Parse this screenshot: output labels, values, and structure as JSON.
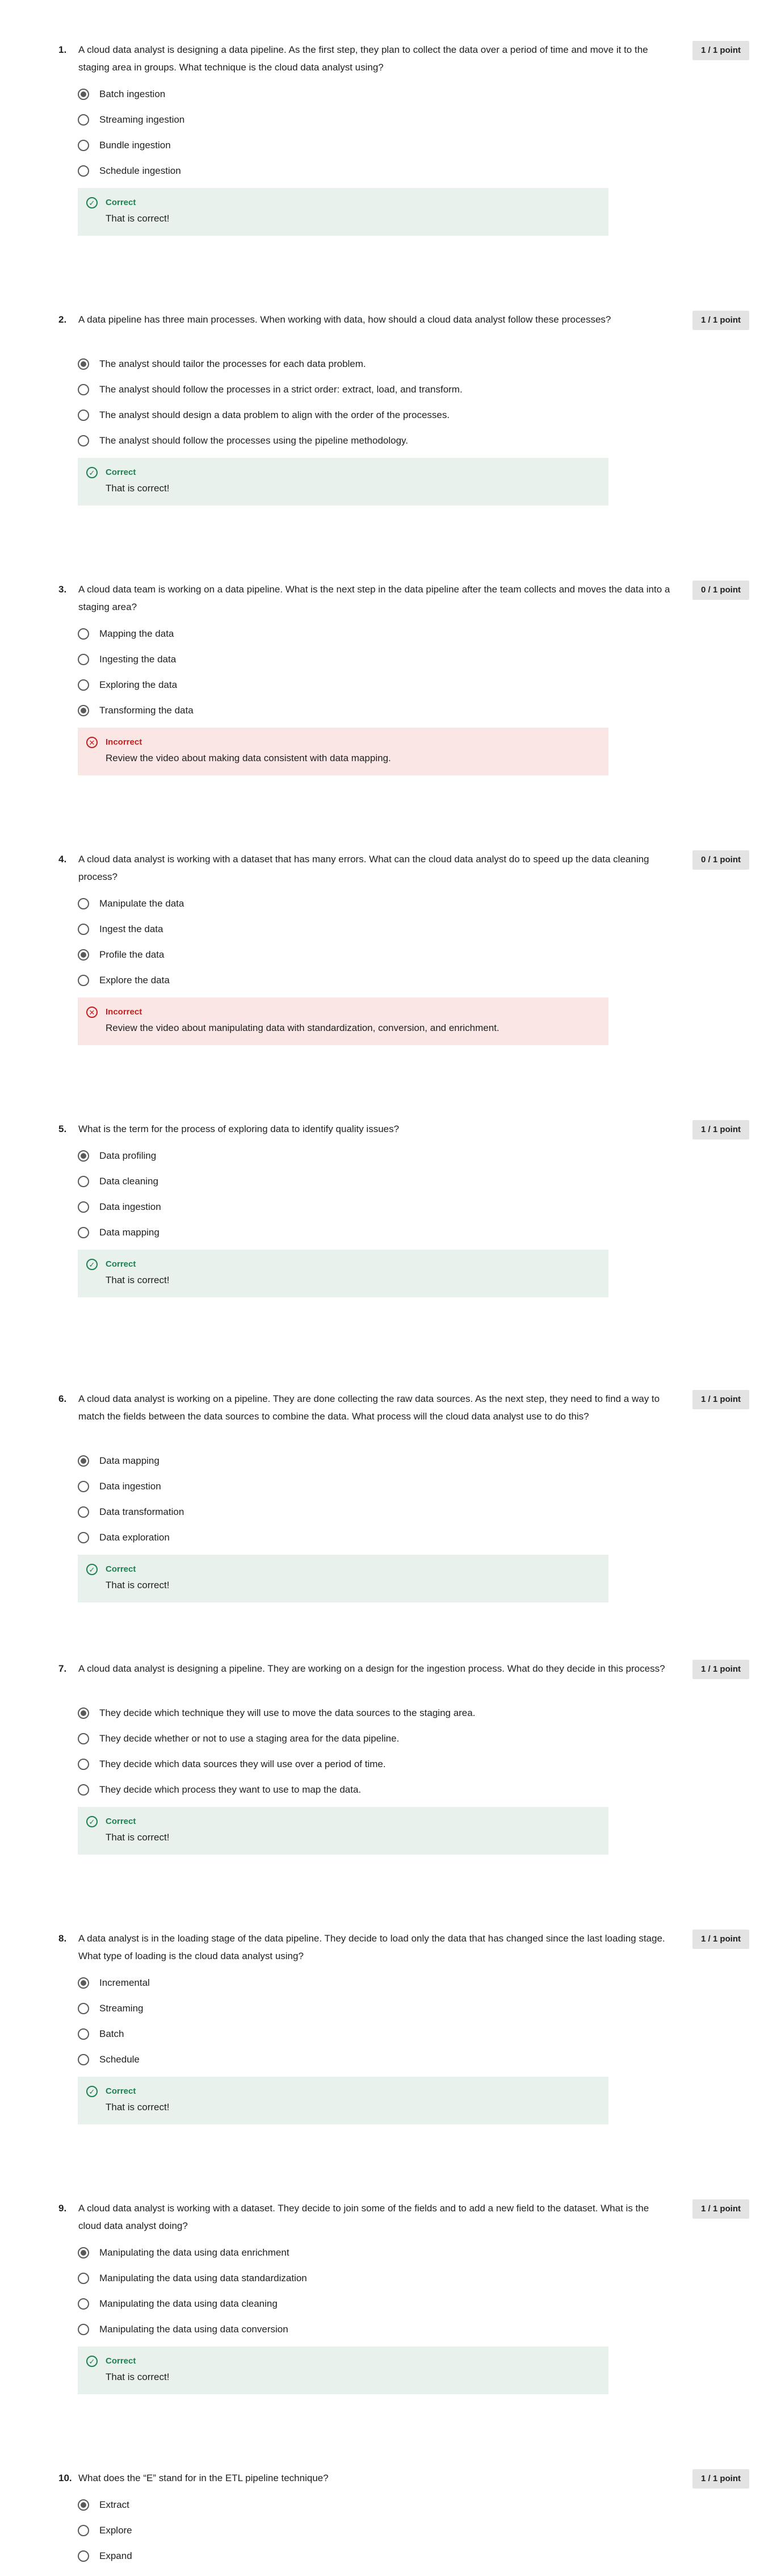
{
  "questions": [
    {
      "number": "1.",
      "text": "A cloud data analyst is designing a data pipeline. As the first step, they plan to collect the data over a period of time and move it to the staging area in groups. What technique is the cloud data analyst using?",
      "score": "1 / 1 point",
      "options": [
        {
          "label": "Batch ingestion",
          "selected": true
        },
        {
          "label": "Streaming ingestion",
          "selected": false
        },
        {
          "label": "Bundle ingestion",
          "selected": false
        },
        {
          "label": "Schedule ingestion",
          "selected": false
        }
      ],
      "feedback": {
        "status": "Correct",
        "message": "That is correct!",
        "type": "correct"
      }
    },
    {
      "number": "2.",
      "text": "A data pipeline has three main processes. When working with data, how should a cloud data analyst follow these processes?",
      "score": "1 / 1 point",
      "options": [
        {
          "label": "The analyst should tailor the processes for each data problem.",
          "selected": true
        },
        {
          "label": "The analyst should follow the processes in a strict order: extract, load, and transform.",
          "selected": false
        },
        {
          "label": "The analyst should design a data problem to align with the order of the processes.",
          "selected": false
        },
        {
          "label": "The analyst should follow the processes using the pipeline methodology.",
          "selected": false
        }
      ],
      "feedback": {
        "status": "Correct",
        "message": "That is correct!",
        "type": "correct"
      }
    },
    {
      "number": "3.",
      "text": " A cloud data team is working on a data pipeline. What is the next step in the data pipeline after the team collects and moves the data into a staging area?",
      "score": "0 / 1 point",
      "options": [
        {
          "label": "Mapping the data",
          "selected": false
        },
        {
          "label": "Ingesting the data",
          "selected": false
        },
        {
          "label": "Exploring the data",
          "selected": false
        },
        {
          "label": "Transforming the data",
          "selected": true
        }
      ],
      "feedback": {
        "status": "Incorrect",
        "message": "Review the video about making data consistent with data mapping.",
        "type": "incorrect"
      }
    },
    {
      "number": "4.",
      "text": "A cloud data analyst is working with a dataset that has many errors. What can the cloud data analyst do to speed up the data cleaning process?",
      "score": "0 / 1 point",
      "options": [
        {
          "label": "Manipulate the data",
          "selected": false
        },
        {
          "label": "Ingest the data",
          "selected": false
        },
        {
          "label": "Profile the data",
          "selected": true
        },
        {
          "label": "Explore the data",
          "selected": false
        }
      ],
      "feedback": {
        "status": "Incorrect",
        "message": "Review the video about manipulating data with standardization, conversion, and enrichment.",
        "type": "incorrect"
      }
    },
    {
      "number": "5.",
      "text": " What is the term for the process of exploring data to identify quality issues?",
      "score": "1 / 1 point",
      "options": [
        {
          "label": "Data profiling",
          "selected": true
        },
        {
          "label": "Data cleaning",
          "selected": false
        },
        {
          "label": "Data ingestion",
          "selected": false
        },
        {
          "label": "Data mapping",
          "selected": false
        }
      ],
      "feedback": {
        "status": "Correct",
        "message": "That is correct!",
        "type": "correct"
      }
    },
    {
      "number": "6.",
      "text": "A cloud data analyst is working on a pipeline. They are done collecting the raw data sources. As the next step, they need to find a way to match the fields between the data sources to combine the data. What process will the cloud data analyst use to do this?",
      "score": "1 / 1 point",
      "options": [
        {
          "label": "Data mapping",
          "selected": true
        },
        {
          "label": "Data ingestion",
          "selected": false
        },
        {
          "label": "Data transformation",
          "selected": false
        },
        {
          "label": "Data exploration",
          "selected": false
        }
      ],
      "feedback": {
        "status": "Correct",
        "message": "That is correct!",
        "type": "correct"
      }
    },
    {
      "number": "7.",
      "text": "A cloud data analyst is designing a pipeline. They are working on a design for the ingestion process. What do they decide in this process?",
      "score": "1 / 1 point",
      "options": [
        {
          "label": "They decide which technique they will use to move the data sources to the staging area.",
          "selected": true
        },
        {
          "label": "They decide whether or not to use a staging area for the data pipeline.",
          "selected": false
        },
        {
          "label": "They decide which data sources they will use over a period of time.",
          "selected": false
        },
        {
          "label": "They decide which process they want to use to map the data.",
          "selected": false
        }
      ],
      "feedback": {
        "status": "Correct",
        "message": "That is correct!",
        "type": "correct"
      }
    },
    {
      "number": "8.",
      "text": "A data analyst is in the loading stage of the data pipeline. They decide to load only the data that has changed since the last loading stage. What type of loading is the cloud data analyst using?",
      "score": "1 / 1 point",
      "options": [
        {
          "label": "Incremental",
          "selected": true
        },
        {
          "label": "Streaming",
          "selected": false
        },
        {
          "label": "Batch",
          "selected": false
        },
        {
          "label": "Schedule",
          "selected": false
        }
      ],
      "feedback": {
        "status": "Correct",
        "message": "That is correct!",
        "type": "correct"
      }
    },
    {
      "number": "9.",
      "text": "A cloud data analyst is working with a dataset. They decide to join some of the fields and to add a new field to the dataset. What is the cloud data analyst doing?",
      "score": "1 / 1 point",
      "options": [
        {
          "label": "Manipulating the data using data enrichment",
          "selected": true
        },
        {
          "label": "Manipulating the data using data standardization",
          "selected": false
        },
        {
          "label": "Manipulating the data using data cleaning",
          "selected": false
        },
        {
          "label": "Manipulating the data using data conversion",
          "selected": false
        }
      ],
      "feedback": {
        "status": "Correct",
        "message": "That is correct!",
        "type": "correct"
      }
    },
    {
      "number": "10.",
      "text": "What does the “E” stand for in the ETL pipeline technique?",
      "score": "1 / 1 point",
      "options": [
        {
          "label": "Extract",
          "selected": true
        },
        {
          "label": "Explore",
          "selected": false
        },
        {
          "label": "Expand",
          "selected": false
        }
      ],
      "feedback": null
    }
  ]
}
